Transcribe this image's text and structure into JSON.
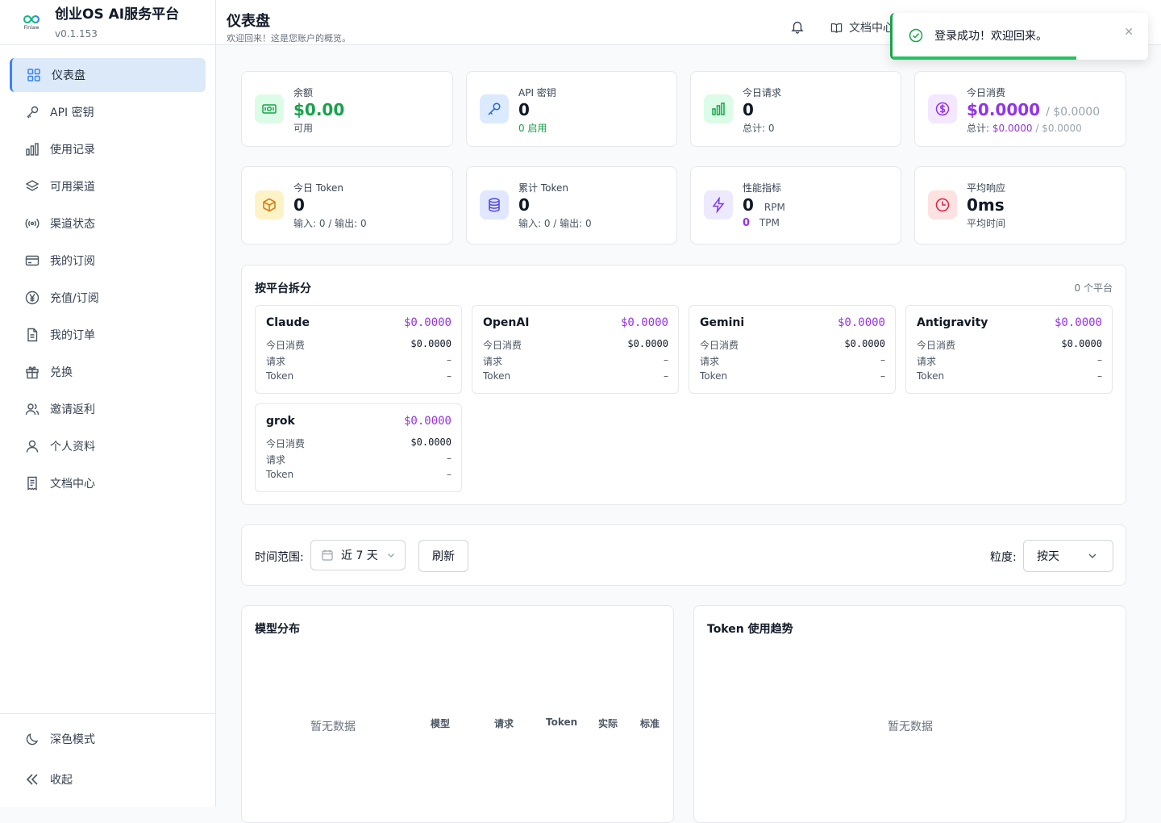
{
  "app": {
    "name": "创业OS AI服务平台",
    "version": "v0.1.153",
    "logo_text": "Finlaw"
  },
  "sidebar": {
    "items": [
      {
        "label": "仪表盘"
      },
      {
        "label": "API 密钥"
      },
      {
        "label": "使用记录"
      },
      {
        "label": "可用渠道"
      },
      {
        "label": "渠道状态"
      },
      {
        "label": "我的订阅"
      },
      {
        "label": "充值/订阅"
      },
      {
        "label": "我的订单"
      },
      {
        "label": "兑换"
      },
      {
        "label": "邀请返利"
      },
      {
        "label": "个人资料"
      },
      {
        "label": "文档中心"
      }
    ],
    "dark_mode": "深色模式",
    "collapse": "收起"
  },
  "header": {
    "title": "仪表盘",
    "subtitle": "欢迎回来！这是您账户的概览。",
    "doc_link": "文档中心"
  },
  "toast": {
    "message": "登录成功！欢迎回来。",
    "progress": 0.72
  },
  "stats": {
    "balance": {
      "label": "余额",
      "value": "$0.00",
      "sub": "可用"
    },
    "api_keys": {
      "label": "API 密钥",
      "value": "0",
      "sub": "0 启用"
    },
    "today_requests": {
      "label": "今日请求",
      "value": "0",
      "sub": "总计: 0"
    },
    "today_cost": {
      "label": "今日消费",
      "value": "$0.0000",
      "value2": "/ $0.0000",
      "sub_label": "总计:",
      "sub_value": "$0.0000",
      "sub_value2": "/ $0.0000"
    },
    "today_token": {
      "label": "今日 Token",
      "value": "0",
      "sub": "输入: 0 / 输出: 0"
    },
    "total_token": {
      "label": "累计 Token",
      "value": "0",
      "sub": "输入: 0 / 输出: 0"
    },
    "perf": {
      "label": "性能指标",
      "rpm_value": "0",
      "rpm_unit": "RPM",
      "tpm_value": "0",
      "tpm_unit": "TPM"
    },
    "avg_resp": {
      "label": "平均响应",
      "value": "0ms",
      "sub": "平均时间"
    }
  },
  "platforms": {
    "title": "按平台拆分",
    "count": "0 个平台",
    "row_labels": {
      "today": "今日消费",
      "requests": "请求",
      "token": "Token"
    },
    "items": [
      {
        "name": "Claude",
        "amount": "$0.0000",
        "today": "$0.0000",
        "requests": "–",
        "token": "–"
      },
      {
        "name": "OpenAI",
        "amount": "$0.0000",
        "today": "$0.0000",
        "requests": "–",
        "token": "–"
      },
      {
        "name": "Gemini",
        "amount": "$0.0000",
        "today": "$0.0000",
        "requests": "–",
        "token": "–"
      },
      {
        "name": "Antigravity",
        "amount": "$0.0000",
        "today": "$0.0000",
        "requests": "–",
        "token": "–"
      },
      {
        "name": "grok",
        "amount": "$0.0000",
        "today": "$0.0000",
        "requests": "–",
        "token": "–"
      }
    ]
  },
  "filters": {
    "range_label": "时间范围:",
    "range_value": "近 7 天",
    "refresh": "刷新",
    "granularity_label": "粒度:",
    "granularity_value": "按天"
  },
  "model_dist": {
    "title": "模型分布",
    "empty": "暂无数据",
    "columns": [
      "模型",
      "请求",
      "Token",
      "实际",
      "标准"
    ]
  },
  "token_trend": {
    "title": "Token 使用趋势",
    "empty": "暂无数据"
  },
  "colors": {
    "accent": "#3b82f6",
    "green": "#16a34a",
    "purple": "#9333ea"
  }
}
